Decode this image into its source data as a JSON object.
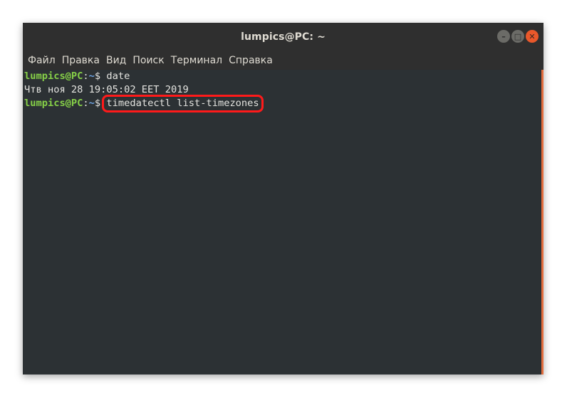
{
  "window": {
    "title": "lumpics@PC: ~",
    "controls": {
      "minimize_glyph": "–",
      "maximize_glyph": "□",
      "close_glyph": "✕"
    }
  },
  "menu": {
    "items": [
      "Файл",
      "Правка",
      "Вид",
      "Поиск",
      "Терминал",
      "Справка"
    ]
  },
  "terminal": {
    "lines": [
      {
        "user_host": "lumpics@PC",
        "sep": ":",
        "path": "~",
        "prompt": "$ ",
        "command": "date"
      },
      {
        "output": "Чтв ноя 28 19:05:02 EET 2019"
      },
      {
        "user_host": "lumpics@PC",
        "sep": ":",
        "path": "~",
        "prompt": "$ ",
        "command": "timedatectl list-timezones"
      }
    ],
    "highlight_color": "#ff1a1a",
    "user_color": "#86d048",
    "path_color": "#6ea5e5"
  },
  "colors": {
    "titlebar": "#2f2f2f",
    "terminal_bg": "#2c3134",
    "close_button": "#e9582b",
    "scrollbar_accent": "#e26d3e"
  }
}
